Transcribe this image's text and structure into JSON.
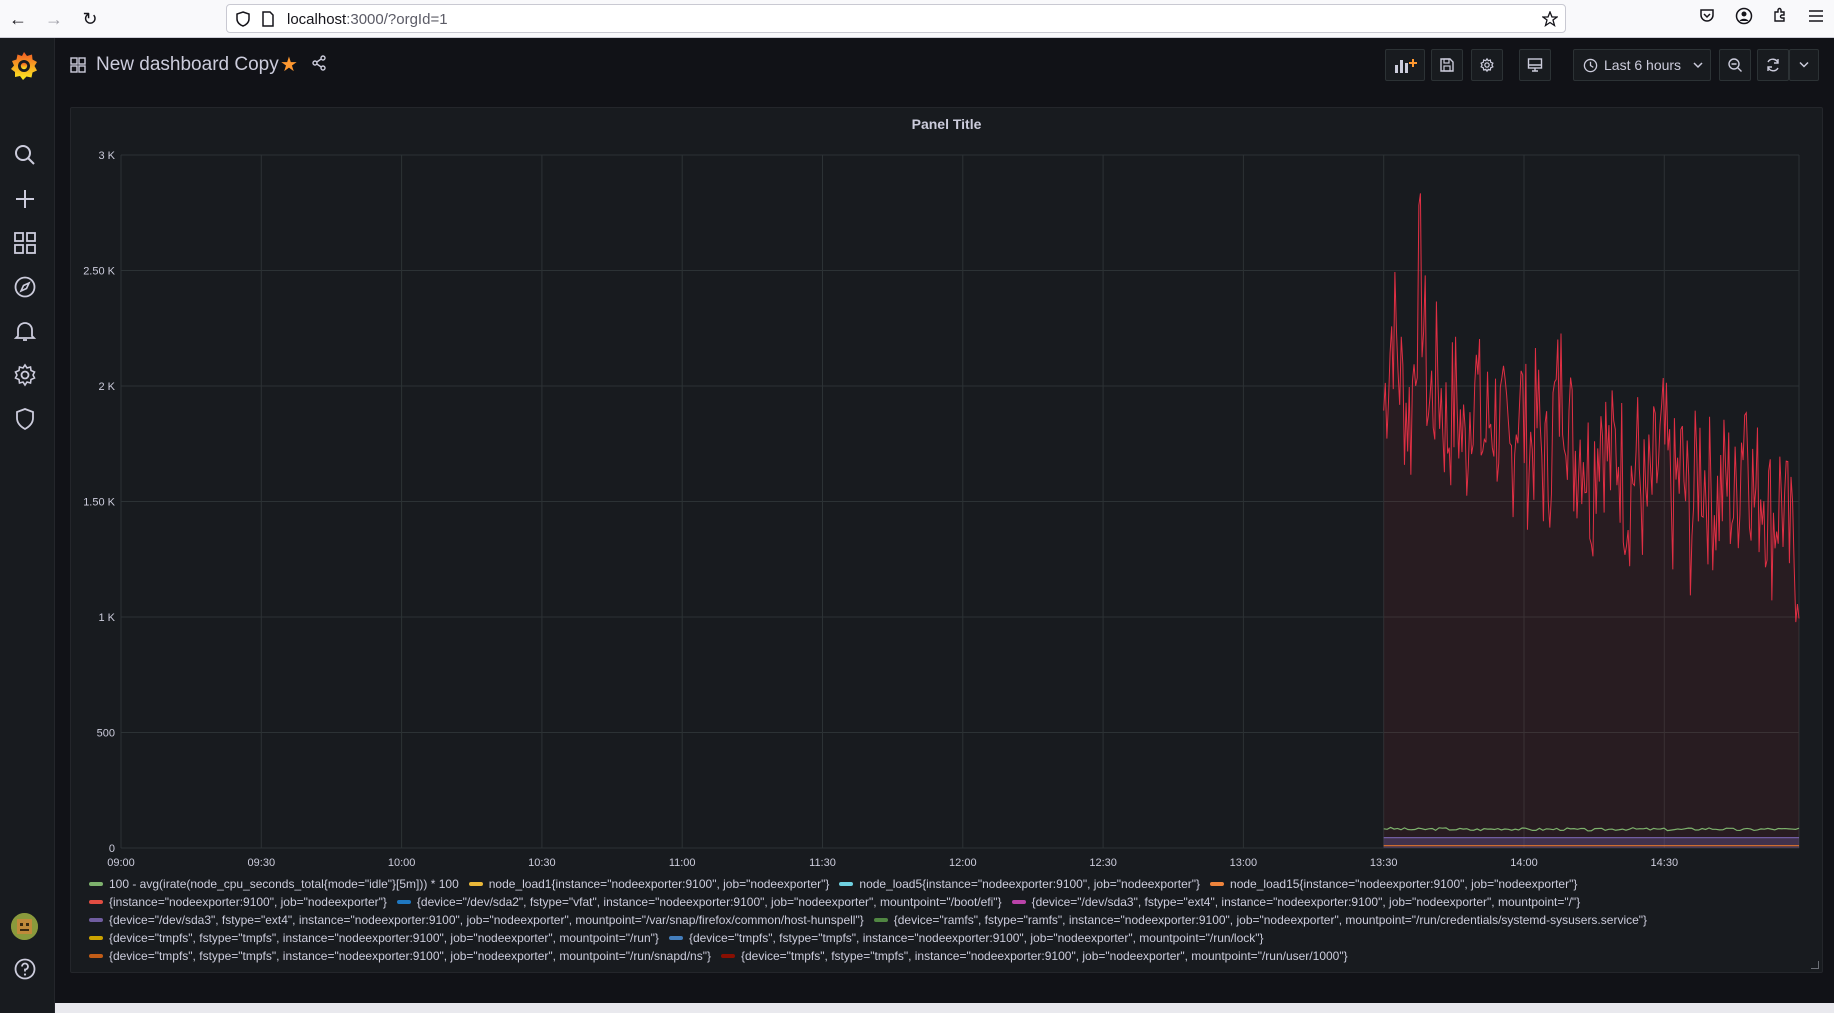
{
  "browser": {
    "url_host": "localhost",
    "url_path": ":3000/?orgId=1"
  },
  "topnav": {
    "title": "New dashboard Copy",
    "time_range": "Last 6 hours"
  },
  "panel": {
    "title": "Panel Title"
  },
  "icons": {
    "sidebar": [
      "grafana-logo-icon",
      "search-icon",
      "plus-icon",
      "dashboards-icon",
      "explore-icon",
      "alert-bell-icon",
      "gear-icon",
      "shield-icon",
      "avatar",
      "help-icon"
    ]
  },
  "colors": {
    "accent_orange": "#ff9830",
    "series_main": "#f2495c"
  },
  "chart_data": {
    "type": "line",
    "title": "Panel Title",
    "x_ticks": [
      "09:00",
      "09:30",
      "10:00",
      "10:30",
      "11:00",
      "11:30",
      "12:00",
      "12:30",
      "13:00",
      "13:30",
      "14:00",
      "14:30"
    ],
    "y_ticks": [
      "0",
      "500",
      "1 K",
      "1.50 K",
      "2 K",
      "2.50 K",
      "3 K"
    ],
    "ylim": [
      0,
      3000
    ],
    "grid": true,
    "legend_position": "bottom",
    "series": [
      {
        "name": "{instance=\"nodeexporter:9100\", job=\"nodeexporter\"}",
        "color": "#e02f44",
        "x_range": [
          "13:30",
          "14:59"
        ],
        "approx_values": [
          1900,
          2300,
          2000,
          1850,
          2550,
          1900,
          2050,
          1800,
          1950,
          1700,
          2100,
          1750,
          1900,
          1800,
          1650,
          2000,
          1700,
          1850,
          1600,
          1900,
          2050,
          1700,
          1800,
          1550,
          1900,
          1650,
          1750,
          1500,
          1700,
          1450,
          1600,
          1750,
          1500,
          1650,
          1400,
          1700,
          1550,
          1500,
          1600,
          1450,
          1950,
          1500,
          1600,
          1400,
          1550,
          1300,
          1250
        ]
      },
      {
        "name": "100 - avg(irate(node_cpu_seconds_total{mode=\"idle\"}[5m])) * 100",
        "color": "#7eb26d",
        "x_range": [
          "13:30",
          "14:59"
        ],
        "approx_values": [
          85,
          80,
          83,
          79,
          84,
          80,
          82,
          78,
          83,
          81,
          80,
          84,
          79,
          82,
          80
        ]
      },
      {
        "name": "{device=\"/dev/sda3\", fstype=\"ext4\", instance=\"nodeexporter:9100\", job=\"nodeexporter\", mountpoint=\"/var/snap/firefox/common/host-hunspell\"}",
        "color": "#705da0",
        "x_range": [
          "13:30",
          "14:59"
        ],
        "approx_values": [
          45,
          45
        ]
      },
      {
        "name": "{device=\"tmpfs\", fstype=\"tmpfs\", instance=\"nodeexporter:9100\", job=\"nodeexporter\", mountpoint=\"/run/snapd/ns\"}",
        "color": "#e0752d",
        "x_range": [
          "13:30",
          "14:59"
        ],
        "approx_values": [
          10,
          10
        ]
      }
    ]
  },
  "legend": [
    [
      {
        "label": "100 - avg(irate(node_cpu_seconds_total{mode=\"idle\"}[5m])) * 100",
        "color": "#7eb26d"
      },
      {
        "label": "node_load1{instance=\"nodeexporter:9100\", job=\"nodeexporter\"}",
        "color": "#eab839"
      },
      {
        "label": "node_load5{instance=\"nodeexporter:9100\", job=\"nodeexporter\"}",
        "color": "#6ed0e0"
      },
      {
        "label": "node_load15{instance=\"nodeexporter:9100\", job=\"nodeexporter\"}",
        "color": "#ef843c"
      }
    ],
    [
      {
        "label": "{instance=\"nodeexporter:9100\", job=\"nodeexporter\"}",
        "color": "#e24d42"
      },
      {
        "label": "{device=\"/dev/sda2\", fstype=\"vfat\", instance=\"nodeexporter:9100\", job=\"nodeexporter\", mountpoint=\"/boot/efi\"}",
        "color": "#1f78c1"
      },
      {
        "label": "{device=\"/dev/sda3\", fstype=\"ext4\", instance=\"nodeexporter:9100\", job=\"nodeexporter\", mountpoint=\"/\"}",
        "color": "#ba43a9"
      }
    ],
    [
      {
        "label": "{device=\"/dev/sda3\", fstype=\"ext4\", instance=\"nodeexporter:9100\", job=\"nodeexporter\", mountpoint=\"/var/snap/firefox/common/host-hunspell\"}",
        "color": "#705da0"
      },
      {
        "label": "{device=\"ramfs\", fstype=\"ramfs\", instance=\"nodeexporter:9100\", job=\"nodeexporter\", mountpoint=\"/run/credentials/systemd-sysusers.service\"}",
        "color": "#508642"
      }
    ],
    [
      {
        "label": "{device=\"tmpfs\", fstype=\"tmpfs\", instance=\"nodeexporter:9100\", job=\"nodeexporter\", mountpoint=\"/run\"}",
        "color": "#cca300"
      },
      {
        "label": "{device=\"tmpfs\", fstype=\"tmpfs\", instance=\"nodeexporter:9100\", job=\"nodeexporter\", mountpoint=\"/run/lock\"}",
        "color": "#447ebc"
      }
    ],
    [
      {
        "label": "{device=\"tmpfs\", fstype=\"tmpfs\", instance=\"nodeexporter:9100\", job=\"nodeexporter\", mountpoint=\"/run/snapd/ns\"}",
        "color": "#c15c17"
      },
      {
        "label": "{device=\"tmpfs\", fstype=\"tmpfs\", instance=\"nodeexporter:9100\", job=\"nodeexporter\", mountpoint=\"/run/user/1000\"}",
        "color": "#890f02"
      }
    ]
  ]
}
